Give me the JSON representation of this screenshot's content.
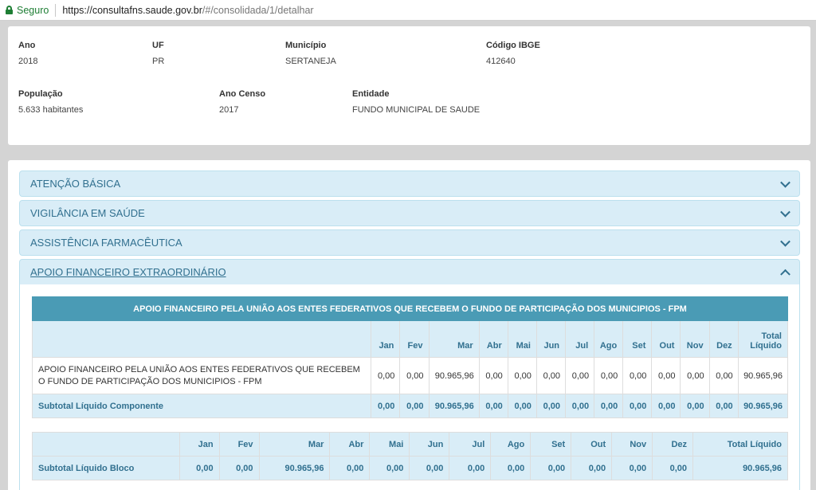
{
  "browser": {
    "secure_label": "Seguro",
    "url_host": "https://consultafns.saude.gov.br",
    "url_path": "/#/consolidada/1/detalhar"
  },
  "info": {
    "ano": {
      "label": "Ano",
      "value": "2018"
    },
    "uf": {
      "label": "UF",
      "value": "PR"
    },
    "municipio": {
      "label": "Município",
      "value": "SERTANEJA"
    },
    "codigo_ibge": {
      "label": "Código IBGE",
      "value": "412640"
    },
    "populacao": {
      "label": "População",
      "value": "5.633 habitantes"
    },
    "ano_censo": {
      "label": "Ano Censo",
      "value": "2017"
    },
    "entidade": {
      "label": "Entidade",
      "value": "FUNDO MUNICIPAL DE SAUDE"
    }
  },
  "accordion": [
    {
      "title": "ATENÇÃO BÁSICA",
      "open": false
    },
    {
      "title": "VIGILÂNCIA EM SAÚDE",
      "open": false
    },
    {
      "title": "ASSISTÊNCIA FARMACÊUTICA",
      "open": false
    },
    {
      "title": "APOIO FINANCEIRO EXTRAORDINÁRIO",
      "open": true
    }
  ],
  "table1": {
    "caption": "APOIO FINANCEIRO PELA UNIÃO AOS ENTES FEDERATIVOS QUE RECEBEM O FUNDO DE PARTICIPAÇÃO DOS MUNICIPIOS - FPM",
    "months": [
      "Jan",
      "Fev",
      "Mar",
      "Abr",
      "Mai",
      "Jun",
      "Jul",
      "Ago",
      "Set",
      "Out",
      "Nov",
      "Dez"
    ],
    "total_header_1": "Total",
    "total_header_2": "Líquido",
    "row": {
      "desc": "APOIO FINANCEIRO PELA UNIÃO AOS ENTES FEDERATIVOS QUE RECEBEM O FUNDO DE PARTICIPAÇÃO DOS MUNICIPIOS - FPM",
      "values": [
        "0,00",
        "0,00",
        "90.965,96",
        "0,00",
        "0,00",
        "0,00",
        "0,00",
        "0,00",
        "0,00",
        "0,00",
        "0,00",
        "0,00"
      ],
      "total": "90.965,96"
    },
    "subtotal": {
      "label": "Subtotal Líquido Componente",
      "values": [
        "0,00",
        "0,00",
        "90.965,96",
        "0,00",
        "0,00",
        "0,00",
        "0,00",
        "0,00",
        "0,00",
        "0,00",
        "0,00",
        "0,00"
      ],
      "total": "90.965,96"
    }
  },
  "table2": {
    "months": [
      "Jan",
      "Fev",
      "Mar",
      "Abr",
      "Mai",
      "Jun",
      "Jul",
      "Ago",
      "Set",
      "Out",
      "Nov",
      "Dez"
    ],
    "total_header": "Total Líquido",
    "subtotal": {
      "label": "Subtotal Líquido Bloco",
      "values": [
        "0,00",
        "0,00",
        "90.965,96",
        "0,00",
        "0,00",
        "0,00",
        "0,00",
        "0,00",
        "0,00",
        "0,00",
        "0,00",
        "0,00"
      ],
      "total": "90.965,96"
    }
  },
  "colors": {
    "accordion_bg": "#d9edf7",
    "accordion_text": "#31708f",
    "table_caption_bg": "#4a9bb5",
    "secure_green": "#1e7e34"
  }
}
